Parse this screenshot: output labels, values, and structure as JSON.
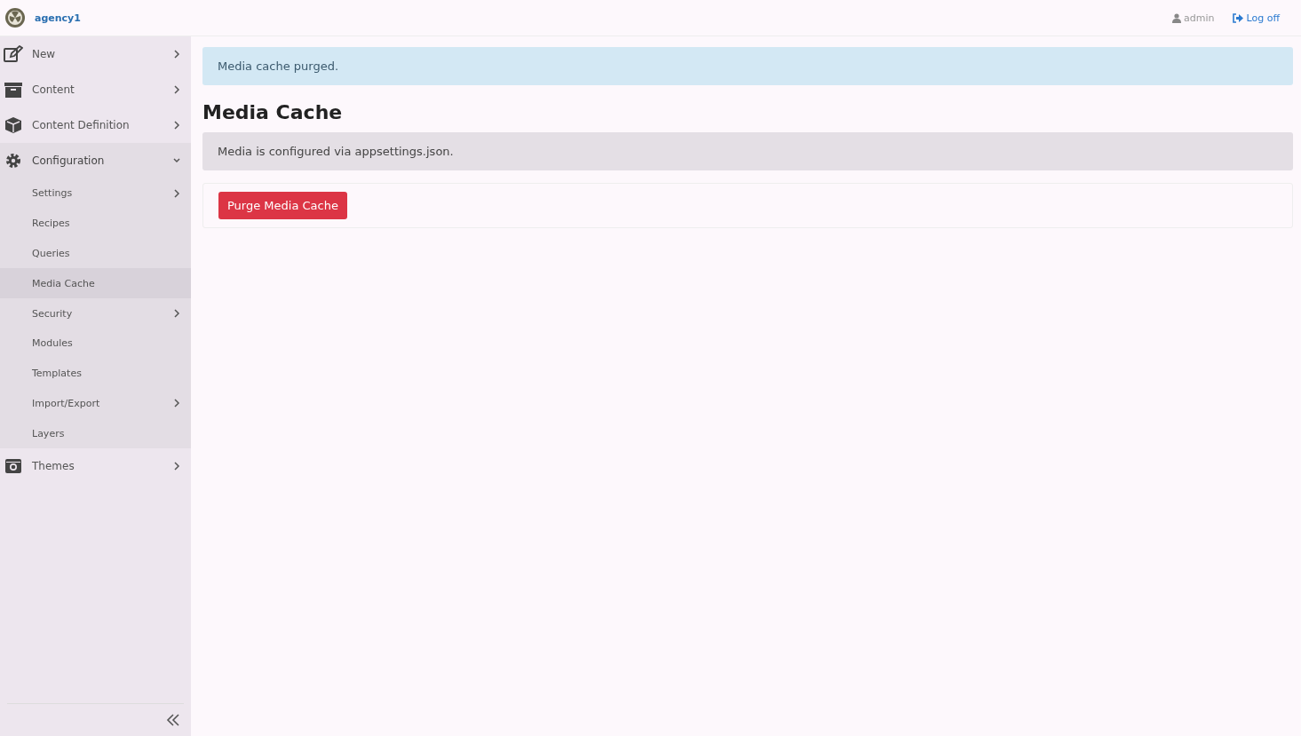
{
  "brand": {
    "name": "agency1"
  },
  "user_menu": {
    "user": "admin",
    "logoff": "Log off"
  },
  "sidebar": {
    "items": [
      {
        "label": "New",
        "has_submenu": true,
        "expanded": false
      },
      {
        "label": "Content",
        "has_submenu": true,
        "expanded": false
      },
      {
        "label": "Content Definition",
        "has_submenu": true,
        "expanded": false
      },
      {
        "label": "Configuration",
        "has_submenu": true,
        "expanded": true,
        "children": [
          {
            "label": "Settings",
            "has_submenu": true,
            "selected": false
          },
          {
            "label": "Recipes",
            "has_submenu": false,
            "selected": false
          },
          {
            "label": "Queries",
            "has_submenu": false,
            "selected": false
          },
          {
            "label": "Media Cache",
            "has_submenu": false,
            "selected": true
          },
          {
            "label": "Security",
            "has_submenu": true,
            "selected": false
          },
          {
            "label": "Modules",
            "has_submenu": false,
            "selected": false
          },
          {
            "label": "Templates",
            "has_submenu": false,
            "selected": false
          },
          {
            "label": "Import/Export",
            "has_submenu": true,
            "selected": false
          },
          {
            "label": "Layers",
            "has_submenu": false,
            "selected": false
          }
        ]
      },
      {
        "label": "Themes",
        "has_submenu": true,
        "expanded": false
      }
    ]
  },
  "alert": {
    "text": "Media cache purged."
  },
  "title": "Media Cache",
  "info": {
    "text": "Media is configured via appsettings.json."
  },
  "purge_button": {
    "label": "Purge Media Cache"
  }
}
